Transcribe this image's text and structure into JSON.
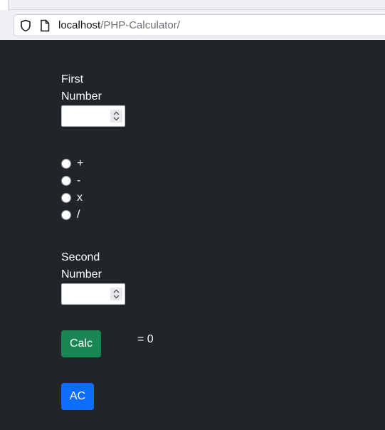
{
  "browser": {
    "url_host": "localhost",
    "url_path": "/PHP-Calculator/"
  },
  "form": {
    "first_number_label_line1": "First",
    "first_number_label_line2": "Number",
    "first_number_value": "",
    "operators": [
      "+",
      "-",
      "x",
      "/"
    ],
    "second_number_label_line1": "Second",
    "second_number_label_line2": "Number",
    "second_number_value": "",
    "calc_button": "Calc",
    "result_text": "= 0",
    "ac_button": "AC"
  },
  "colors": {
    "page_background": "#212529",
    "calc_button": "#198754",
    "ac_button": "#0d6efd"
  }
}
